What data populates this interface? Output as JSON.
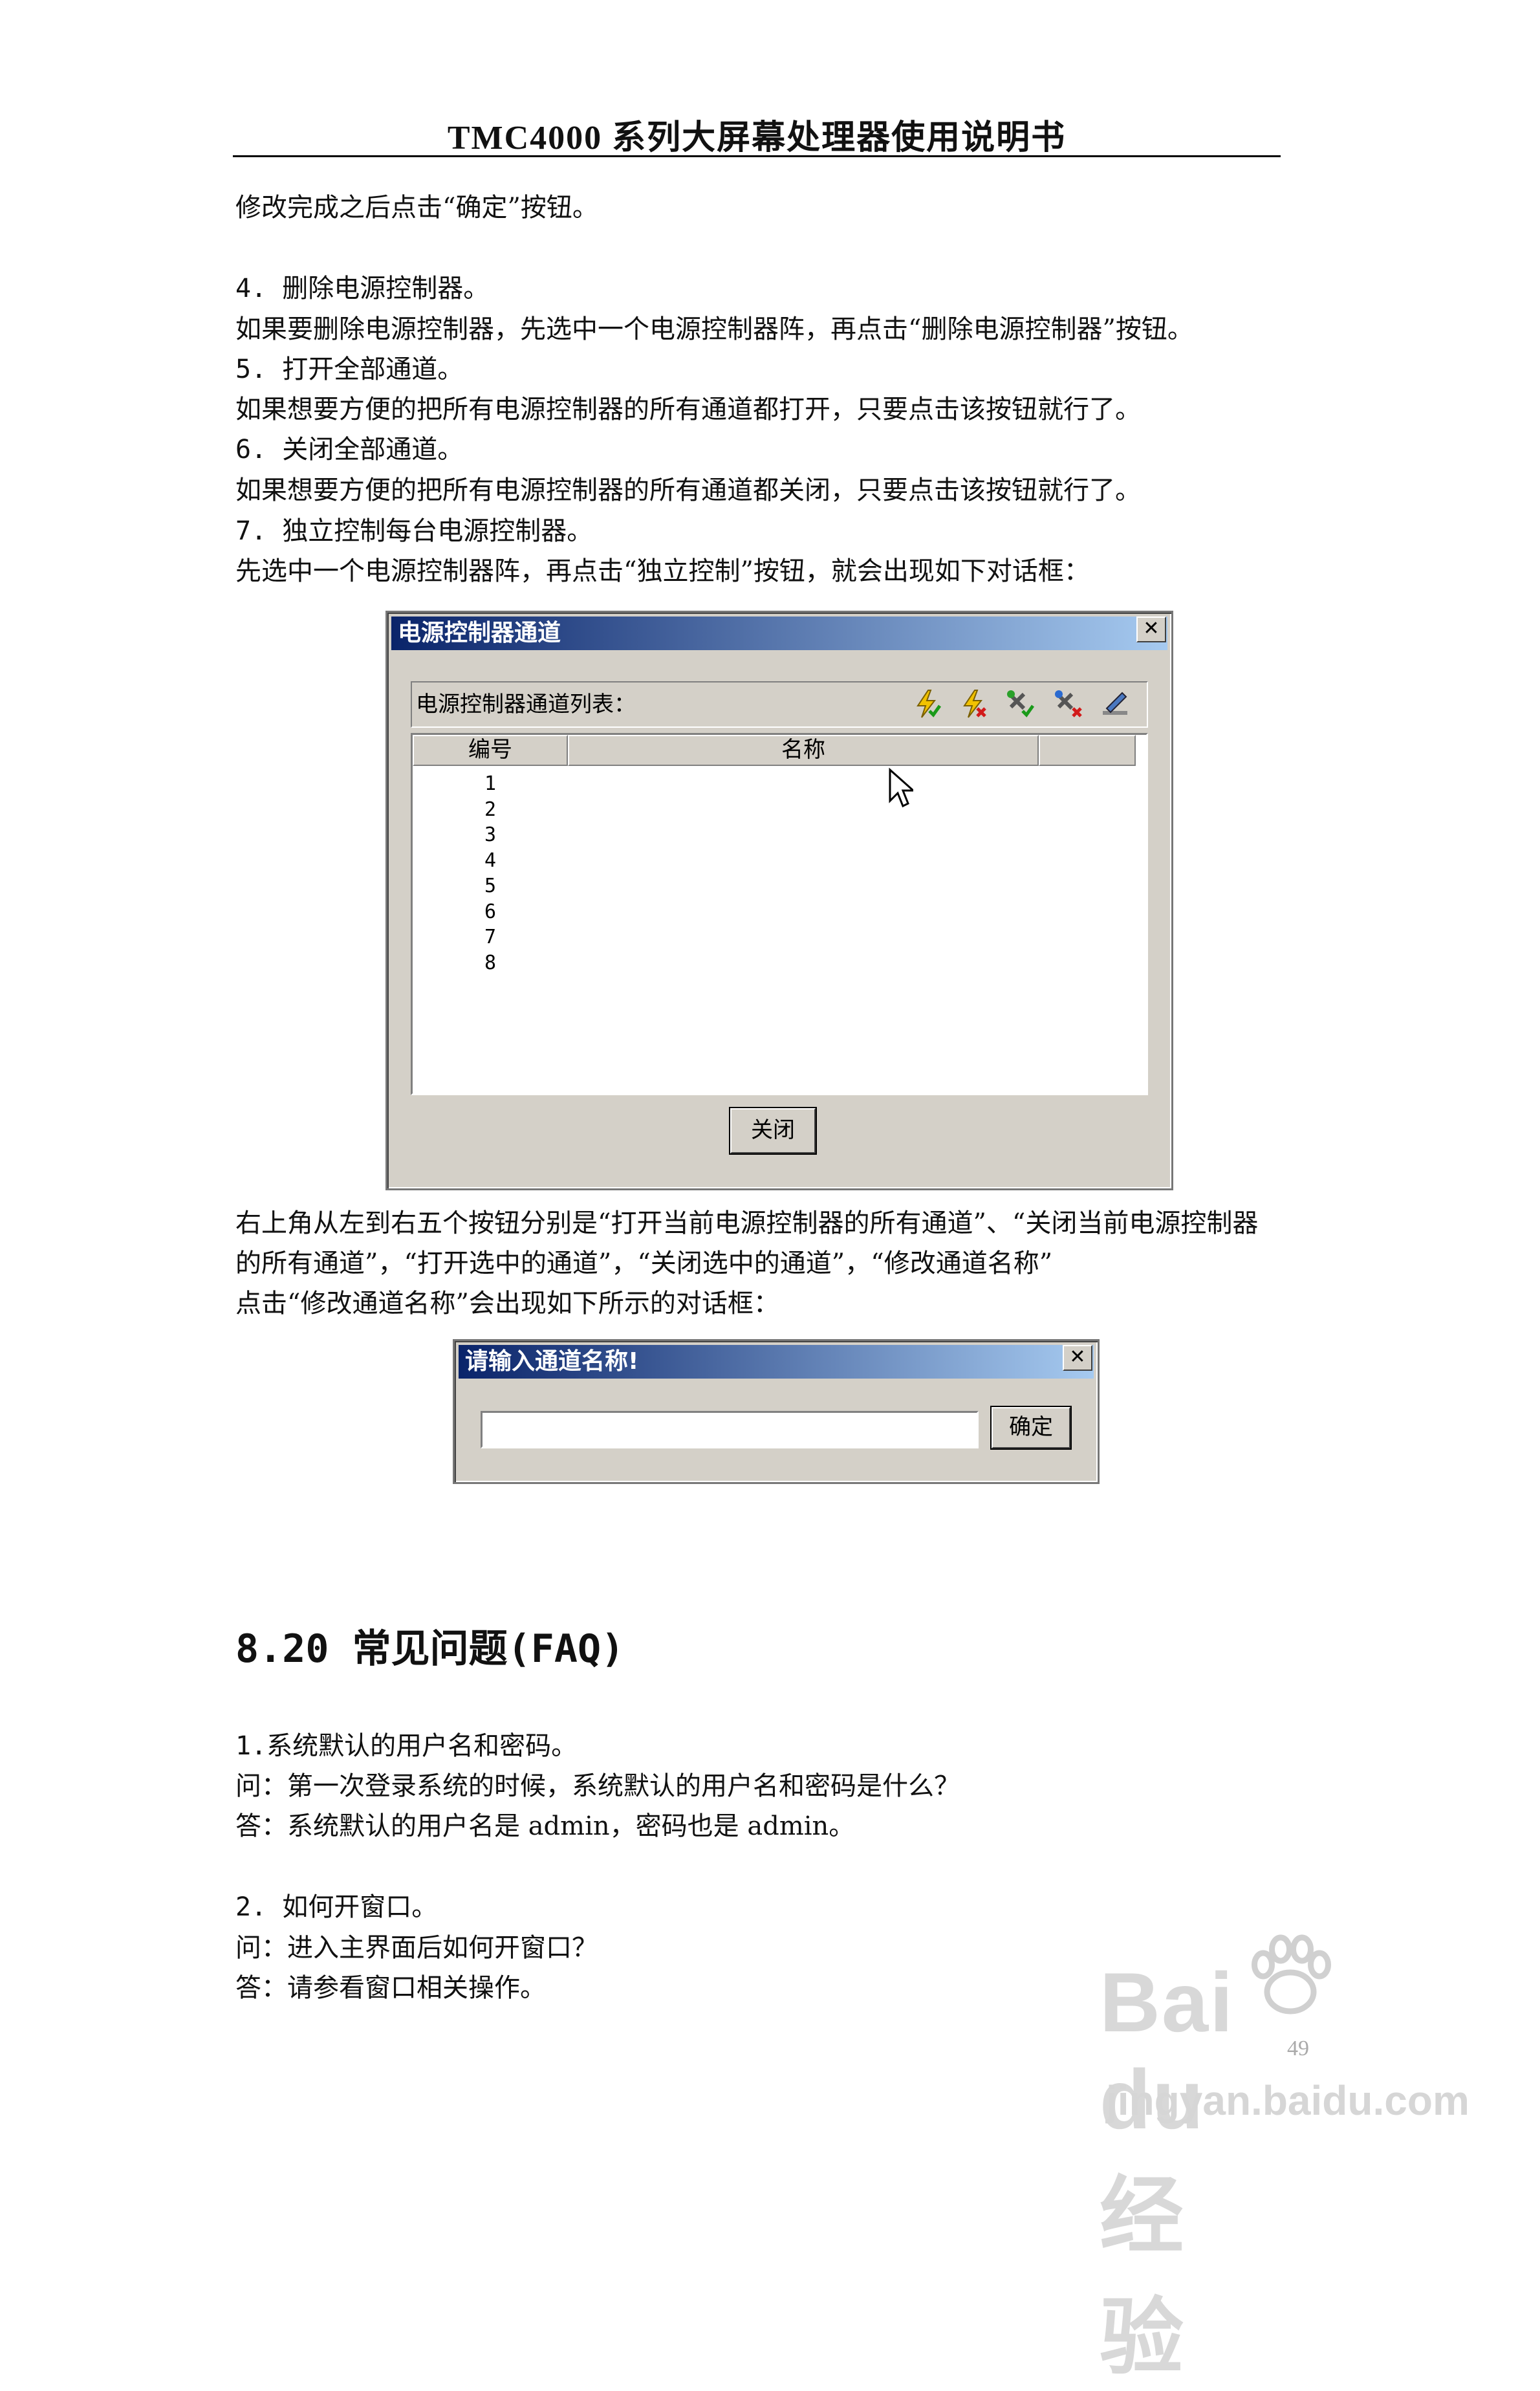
{
  "header": {
    "title": "TMC4000 系列大屏幕处理器使用说明书"
  },
  "paragraphs": {
    "p0": "修改完成之后点击“确定”按钮。",
    "p1": "4. 删除电源控制器。",
    "p2": "如果要删除电源控制器，先选中一个电源控制器阵，再点击“删除电源控制器”按钮。",
    "p3": "5. 打开全部通道。",
    "p4": "如果想要方便的把所有电源控制器的所有通道都打开，只要点击该按钮就行了。",
    "p5": "6. 关闭全部通道。",
    "p6": "如果想要方便的把所有电源控制器的所有通道都关闭，只要点击该按钮就行了。",
    "p7": "7. 独立控制每台电源控制器。",
    "p8": "先选中一个电源控制器阵，再点击“独立控制”按钮，就会出现如下对话框：",
    "p9": "右上角从左到右五个按钮分别是“打开当前电源控制器的所有通道”、“关闭当前电源控制器",
    "p10": "的所有通道”，“打开选中的通道”，“关闭选中的通道”，“修改通道名称”",
    "p11": "点击“修改通道名称”会出现如下所示的对话框："
  },
  "dialog_channels": {
    "title": "电源控制器通道",
    "close_glyph": "✕",
    "toolbar_label": "电源控制器通道列表：",
    "columns": [
      "编号",
      "名称",
      ""
    ],
    "rows": [
      "1",
      "2",
      "3",
      "4",
      "5",
      "6",
      "7",
      "8"
    ],
    "close_button": "关闭",
    "icons": [
      "open-all-channels-icon",
      "close-all-channels-icon",
      "open-selected-channel-icon",
      "close-selected-channel-icon",
      "rename-channel-icon"
    ]
  },
  "dialog_name": {
    "title": "请输入通道名称!",
    "close_glyph": "✕",
    "input_value": "",
    "ok_button": "确定"
  },
  "faq": {
    "title": "8.20 常见问题(FAQ)",
    "q1_title": "1.系统默认的用户名和密码。",
    "q1_q": "问：第一次登录系统的时候，系统默认的用户名和密码是什么？",
    "q1_a": "答：系统默认的用户名是 admin，密码也是 admin。",
    "q2_title": "2. 如何开窗口。",
    "q2_q": "问：进入主界面后如何开窗口？",
    "q2_a": "答：请参看窗口相关操作。"
  },
  "watermark": {
    "logo": "Bai du 经验",
    "url": "jingyan.baidu.com"
  },
  "page_number": "49"
}
